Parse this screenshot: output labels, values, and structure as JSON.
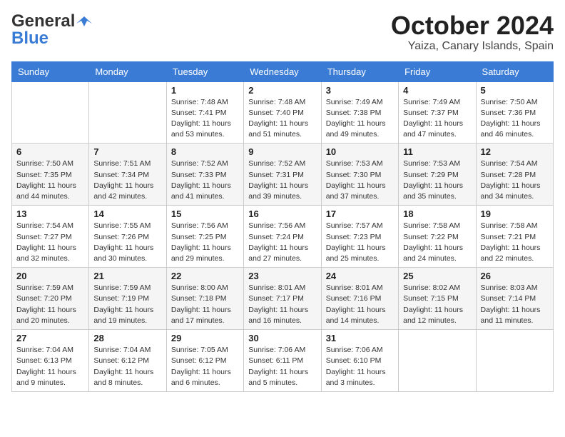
{
  "header": {
    "logo_general": "General",
    "logo_blue": "Blue",
    "title": "October 2024",
    "location": "Yaiza, Canary Islands, Spain"
  },
  "weekdays": [
    "Sunday",
    "Monday",
    "Tuesday",
    "Wednesday",
    "Thursday",
    "Friday",
    "Saturday"
  ],
  "weeks": [
    [
      {
        "day": "",
        "sunrise": "",
        "sunset": "",
        "daylight": ""
      },
      {
        "day": "",
        "sunrise": "",
        "sunset": "",
        "daylight": ""
      },
      {
        "day": "1",
        "sunrise": "Sunrise: 7:48 AM",
        "sunset": "Sunset: 7:41 PM",
        "daylight": "Daylight: 11 hours and 53 minutes."
      },
      {
        "day": "2",
        "sunrise": "Sunrise: 7:48 AM",
        "sunset": "Sunset: 7:40 PM",
        "daylight": "Daylight: 11 hours and 51 minutes."
      },
      {
        "day": "3",
        "sunrise": "Sunrise: 7:49 AM",
        "sunset": "Sunset: 7:38 PM",
        "daylight": "Daylight: 11 hours and 49 minutes."
      },
      {
        "day": "4",
        "sunrise": "Sunrise: 7:49 AM",
        "sunset": "Sunset: 7:37 PM",
        "daylight": "Daylight: 11 hours and 47 minutes."
      },
      {
        "day": "5",
        "sunrise": "Sunrise: 7:50 AM",
        "sunset": "Sunset: 7:36 PM",
        "daylight": "Daylight: 11 hours and 46 minutes."
      }
    ],
    [
      {
        "day": "6",
        "sunrise": "Sunrise: 7:50 AM",
        "sunset": "Sunset: 7:35 PM",
        "daylight": "Daylight: 11 hours and 44 minutes."
      },
      {
        "day": "7",
        "sunrise": "Sunrise: 7:51 AM",
        "sunset": "Sunset: 7:34 PM",
        "daylight": "Daylight: 11 hours and 42 minutes."
      },
      {
        "day": "8",
        "sunrise": "Sunrise: 7:52 AM",
        "sunset": "Sunset: 7:33 PM",
        "daylight": "Daylight: 11 hours and 41 minutes."
      },
      {
        "day": "9",
        "sunrise": "Sunrise: 7:52 AM",
        "sunset": "Sunset: 7:31 PM",
        "daylight": "Daylight: 11 hours and 39 minutes."
      },
      {
        "day": "10",
        "sunrise": "Sunrise: 7:53 AM",
        "sunset": "Sunset: 7:30 PM",
        "daylight": "Daylight: 11 hours and 37 minutes."
      },
      {
        "day": "11",
        "sunrise": "Sunrise: 7:53 AM",
        "sunset": "Sunset: 7:29 PM",
        "daylight": "Daylight: 11 hours and 35 minutes."
      },
      {
        "day": "12",
        "sunrise": "Sunrise: 7:54 AM",
        "sunset": "Sunset: 7:28 PM",
        "daylight": "Daylight: 11 hours and 34 minutes."
      }
    ],
    [
      {
        "day": "13",
        "sunrise": "Sunrise: 7:54 AM",
        "sunset": "Sunset: 7:27 PM",
        "daylight": "Daylight: 11 hours and 32 minutes."
      },
      {
        "day": "14",
        "sunrise": "Sunrise: 7:55 AM",
        "sunset": "Sunset: 7:26 PM",
        "daylight": "Daylight: 11 hours and 30 minutes."
      },
      {
        "day": "15",
        "sunrise": "Sunrise: 7:56 AM",
        "sunset": "Sunset: 7:25 PM",
        "daylight": "Daylight: 11 hours and 29 minutes."
      },
      {
        "day": "16",
        "sunrise": "Sunrise: 7:56 AM",
        "sunset": "Sunset: 7:24 PM",
        "daylight": "Daylight: 11 hours and 27 minutes."
      },
      {
        "day": "17",
        "sunrise": "Sunrise: 7:57 AM",
        "sunset": "Sunset: 7:23 PM",
        "daylight": "Daylight: 11 hours and 25 minutes."
      },
      {
        "day": "18",
        "sunrise": "Sunrise: 7:58 AM",
        "sunset": "Sunset: 7:22 PM",
        "daylight": "Daylight: 11 hours and 24 minutes."
      },
      {
        "day": "19",
        "sunrise": "Sunrise: 7:58 AM",
        "sunset": "Sunset: 7:21 PM",
        "daylight": "Daylight: 11 hours and 22 minutes."
      }
    ],
    [
      {
        "day": "20",
        "sunrise": "Sunrise: 7:59 AM",
        "sunset": "Sunset: 7:20 PM",
        "daylight": "Daylight: 11 hours and 20 minutes."
      },
      {
        "day": "21",
        "sunrise": "Sunrise: 7:59 AM",
        "sunset": "Sunset: 7:19 PM",
        "daylight": "Daylight: 11 hours and 19 minutes."
      },
      {
        "day": "22",
        "sunrise": "Sunrise: 8:00 AM",
        "sunset": "Sunset: 7:18 PM",
        "daylight": "Daylight: 11 hours and 17 minutes."
      },
      {
        "day": "23",
        "sunrise": "Sunrise: 8:01 AM",
        "sunset": "Sunset: 7:17 PM",
        "daylight": "Daylight: 11 hours and 16 minutes."
      },
      {
        "day": "24",
        "sunrise": "Sunrise: 8:01 AM",
        "sunset": "Sunset: 7:16 PM",
        "daylight": "Daylight: 11 hours and 14 minutes."
      },
      {
        "day": "25",
        "sunrise": "Sunrise: 8:02 AM",
        "sunset": "Sunset: 7:15 PM",
        "daylight": "Daylight: 11 hours and 12 minutes."
      },
      {
        "day": "26",
        "sunrise": "Sunrise: 8:03 AM",
        "sunset": "Sunset: 7:14 PM",
        "daylight": "Daylight: 11 hours and 11 minutes."
      }
    ],
    [
      {
        "day": "27",
        "sunrise": "Sunrise: 7:04 AM",
        "sunset": "Sunset: 6:13 PM",
        "daylight": "Daylight: 11 hours and 9 minutes."
      },
      {
        "day": "28",
        "sunrise": "Sunrise: 7:04 AM",
        "sunset": "Sunset: 6:12 PM",
        "daylight": "Daylight: 11 hours and 8 minutes."
      },
      {
        "day": "29",
        "sunrise": "Sunrise: 7:05 AM",
        "sunset": "Sunset: 6:12 PM",
        "daylight": "Daylight: 11 hours and 6 minutes."
      },
      {
        "day": "30",
        "sunrise": "Sunrise: 7:06 AM",
        "sunset": "Sunset: 6:11 PM",
        "daylight": "Daylight: 11 hours and 5 minutes."
      },
      {
        "day": "31",
        "sunrise": "Sunrise: 7:06 AM",
        "sunset": "Sunset: 6:10 PM",
        "daylight": "Daylight: 11 hours and 3 minutes."
      },
      {
        "day": "",
        "sunrise": "",
        "sunset": "",
        "daylight": ""
      },
      {
        "day": "",
        "sunrise": "",
        "sunset": "",
        "daylight": ""
      }
    ]
  ]
}
